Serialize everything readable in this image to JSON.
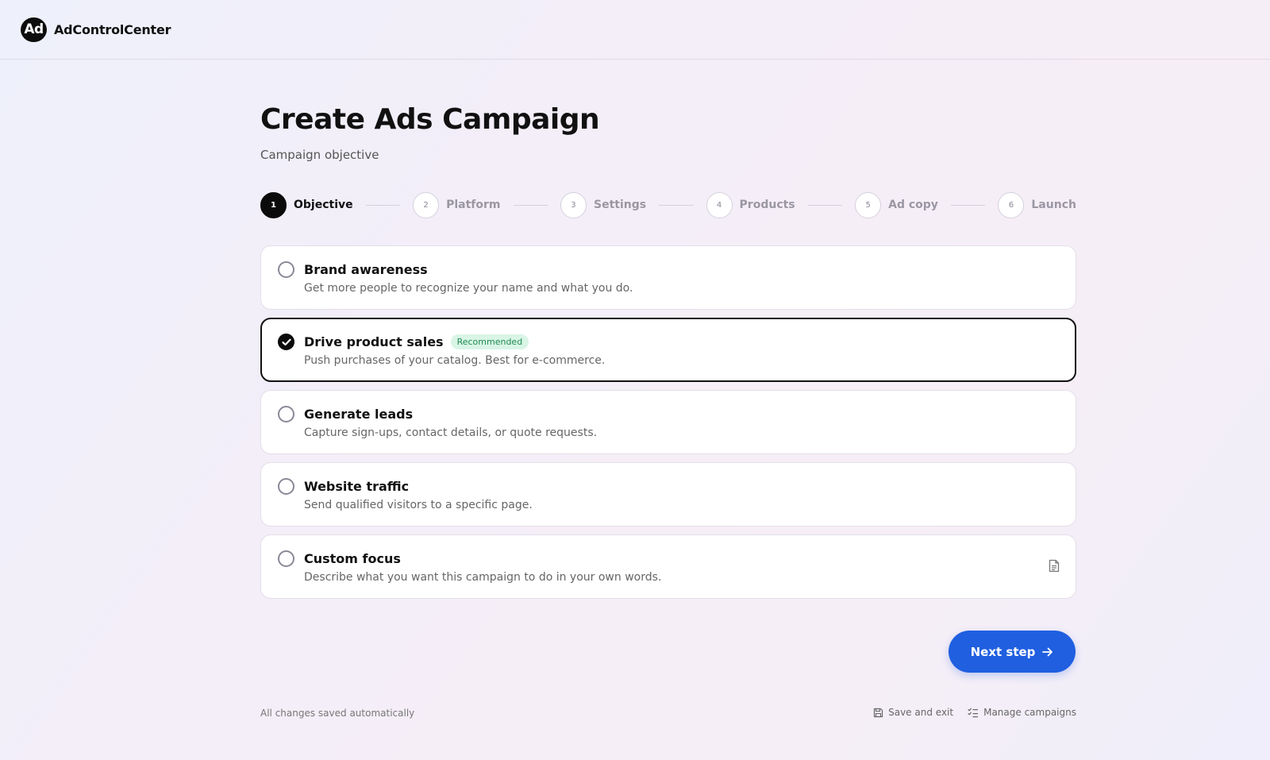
{
  "header": {
    "logo_text": "Ad",
    "brand_name": "AdControlCenter"
  },
  "page": {
    "title": "Create Ads Campaign",
    "subtitle": "Campaign objective"
  },
  "stepper": {
    "steps": [
      {
        "number": "1",
        "label": "Objective",
        "active": true
      },
      {
        "number": "2",
        "label": "Platform",
        "active": false
      },
      {
        "number": "3",
        "label": "Settings",
        "active": false
      },
      {
        "number": "4",
        "label": "Products",
        "active": false
      },
      {
        "number": "5",
        "label": "Ad copy",
        "active": false
      },
      {
        "number": "6",
        "label": "Launch",
        "active": false
      }
    ]
  },
  "objectives": [
    {
      "title": "Brand awareness",
      "description": "Get more people to recognize your name and what you do.",
      "selected": false
    },
    {
      "title": "Drive product sales",
      "description": "Push purchases of your catalog. Best for e-commerce.",
      "selected": true,
      "badge": "Recommended"
    },
    {
      "title": "Generate leads",
      "description": "Capture sign-ups, contact details, or quote requests.",
      "selected": false
    },
    {
      "title": "Website traffic",
      "description": "Send qualified visitors to a specific page.",
      "selected": false
    },
    {
      "title": "Custom focus",
      "description": "Describe what you want this campaign to do in your own words.",
      "selected": false,
      "icon": "document-icon"
    }
  ],
  "actions": {
    "next_label": "Next step"
  },
  "footer": {
    "autosave_note": "All changes saved automatically",
    "save_exit_label": "Save and exit",
    "manage_label": "Manage campaigns"
  },
  "colors": {
    "primary": "#1f5fe0",
    "badge_bg": "#d9f5e6",
    "badge_text": "#1f8b52",
    "selected_border": "#111111"
  }
}
